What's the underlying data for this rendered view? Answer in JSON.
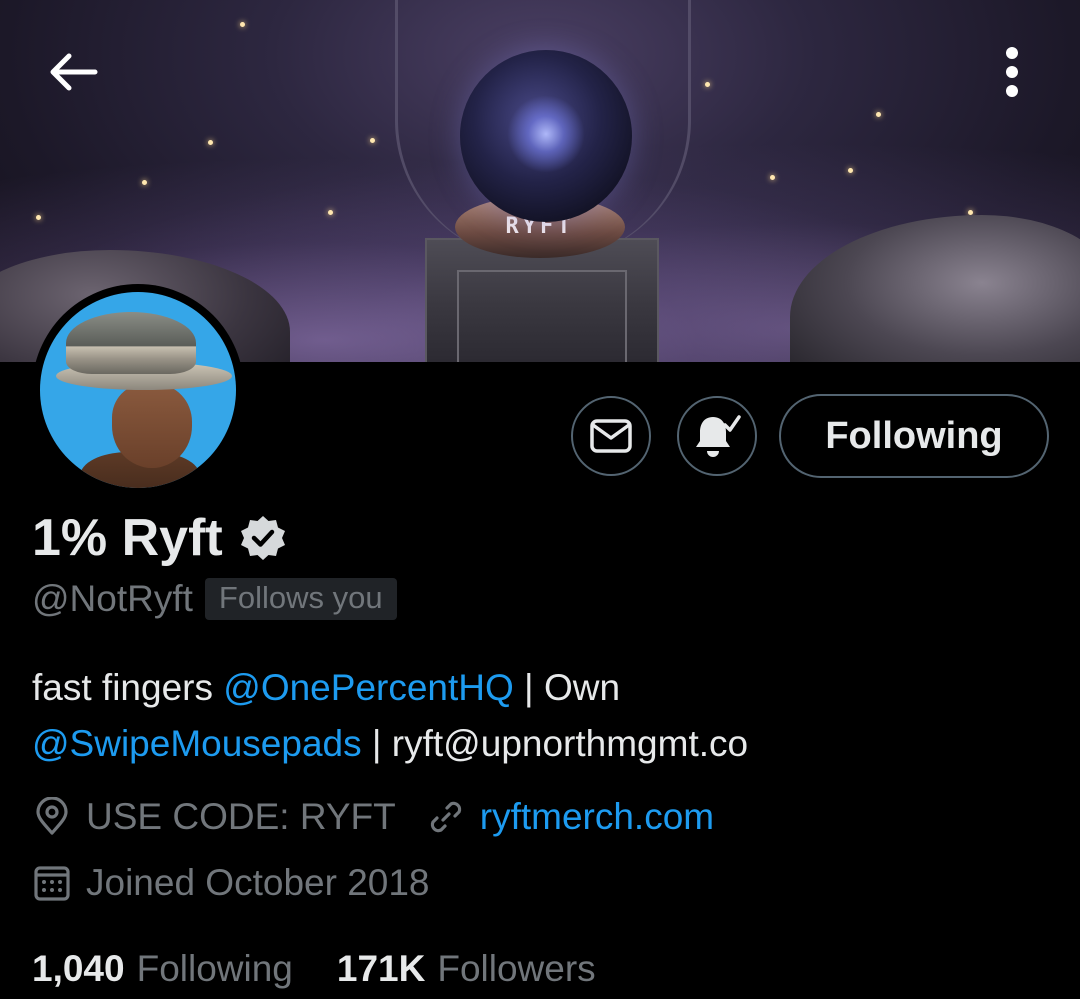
{
  "banner": {
    "ring_text": "RYFT"
  },
  "profile": {
    "display_name": "1% Ryft",
    "handle": "@NotRyft",
    "follows_you": "Follows you",
    "bio": {
      "part1": "fast fingers ",
      "mention1": "@OnePercentHQ",
      "part2": " | Own",
      "mention2": "@SwipeMousepads",
      "part3": " | ryft@upnorthmgmt.co"
    },
    "location": "USE CODE: RYFT",
    "website": "ryftmerch.com",
    "joined": "Joined October 2018"
  },
  "actions": {
    "following_label": "Following"
  },
  "stats": {
    "following_count": "1,040",
    "following_label": "Following",
    "followers_count": "171K",
    "followers_label": "Followers"
  },
  "icons": {
    "back": "arrow-left-icon",
    "more": "more-vertical-icon",
    "message": "envelope-icon",
    "notifications": "bell-check-icon",
    "verified": "verified-badge-icon",
    "location": "location-pin-icon",
    "link": "link-icon",
    "calendar": "calendar-icon"
  },
  "colors": {
    "accent": "#1d9bf0",
    "muted": "#71767b",
    "text": "#e7e9ea",
    "background": "#000000"
  }
}
